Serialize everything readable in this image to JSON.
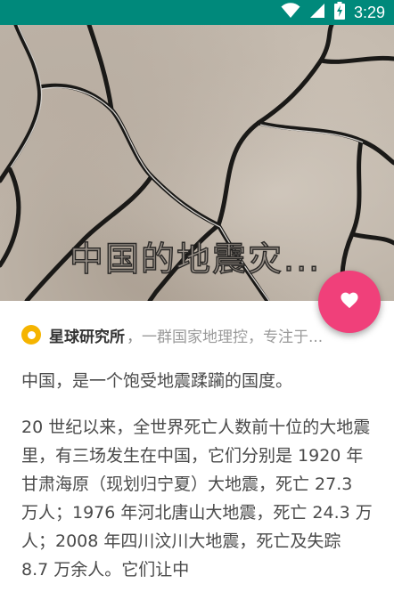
{
  "status_bar": {
    "time": "3:29",
    "icons": [
      "wifi-icon",
      "signal-icon",
      "battery-charging-icon"
    ],
    "color": "#00897B"
  },
  "hero": {
    "title": "中国的地震灾..."
  },
  "fab": {
    "icon": "heart-icon",
    "color": "#F0407A"
  },
  "author": {
    "badge_icon": "author-badge-icon",
    "badge_color": "#F5B400",
    "name": "星球研究所",
    "separator": "，",
    "description": "一群国家地理控，专注于..."
  },
  "article": {
    "paragraphs": [
      "中国，是一个饱受地震蹂躏的国度。",
      "20 世纪以来，全世界死亡人数前十位的大地震里，有三场发生在中国，它们分别是 1920 年甘肃海原（现划归宁夏）大地震，死亡 27.3 万人；1976 年河北唐山大地震，死亡 24.3 万人；2008 年四川汶川大地震，死亡及失踪 8.7 万余人。它们让中"
    ]
  }
}
